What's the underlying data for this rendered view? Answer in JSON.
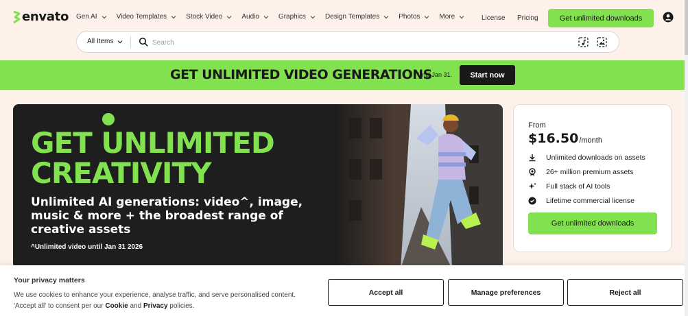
{
  "brand": {
    "name": "envato",
    "accent": "#82e14f",
    "dark": "#191919"
  },
  "nav": {
    "items": [
      {
        "label": "Gen AI"
      },
      {
        "label": "Video Templates"
      },
      {
        "label": "Stock Video"
      },
      {
        "label": "Audio"
      },
      {
        "label": "Graphics"
      },
      {
        "label": "Design Templates"
      },
      {
        "label": "Photos"
      },
      {
        "label": "More"
      }
    ],
    "license": "License",
    "pricing": "Pricing",
    "cta": "Get unlimited downloads",
    "user_icon": "user-icon"
  },
  "search": {
    "category": "All Items",
    "placeholder": "Search",
    "value": "",
    "icons": [
      "search-icon",
      "audio-search-icon",
      "image-search-icon"
    ]
  },
  "promo": {
    "title": "GET UNLIMITED VIDEO GENERATIONS",
    "subtitle": "Until Jan 31.",
    "button": "Start now"
  },
  "hero": {
    "title_line1": "GET UNLIMITED",
    "title_line2": "CREATIVITY",
    "subtitle": "Unlimited AI generations: video^, image, music & more + the broadest range of creative assets",
    "note": "^Unlimited video until Jan 31 2026"
  },
  "pricing_card": {
    "from": "From",
    "price": "$16.50",
    "period": "/month",
    "features": [
      {
        "icon": "download-icon",
        "label": "Unlimited downloads on assets"
      },
      {
        "icon": "badge-icon",
        "label": "26+ million premium assets"
      },
      {
        "icon": "sparkle-icon",
        "label": "Full stack of AI tools"
      },
      {
        "icon": "check-badge-icon",
        "label": "Lifetime commercial license"
      }
    ],
    "button": "Get unlimited downloads"
  },
  "cookie": {
    "title": "Your privacy matters",
    "text_part1": "We use cookies to enhance your experience, analyse traffic, and serve personalised content. 'Accept all' to consent per our ",
    "cookie_link": "Cookie",
    "and": " and ",
    "privacy_link": "Privacy",
    "text_part2": " policies.",
    "accept": "Accept all",
    "manage": "Manage preferences",
    "reject": "Reject all"
  }
}
